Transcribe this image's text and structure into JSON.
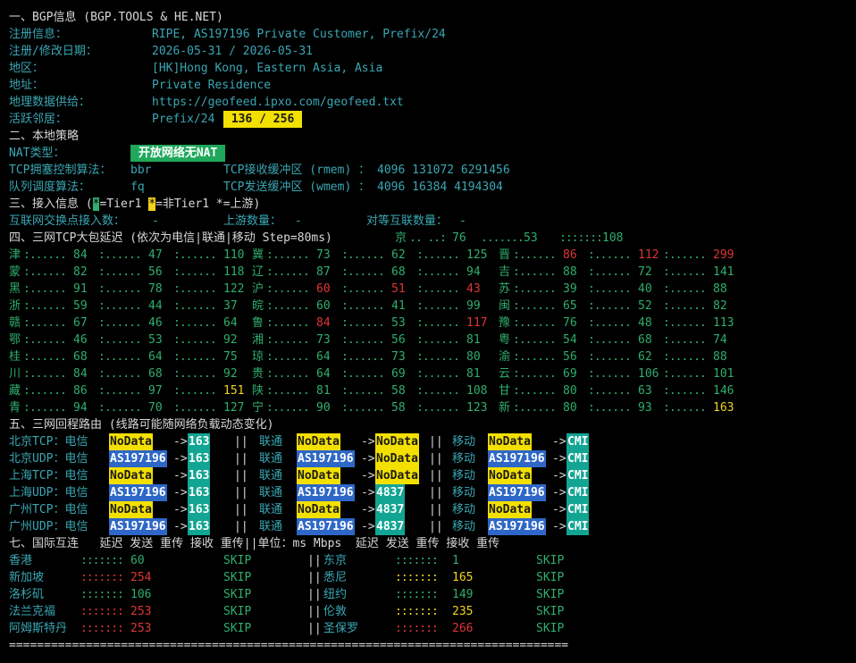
{
  "s1": {
    "title": "一、BGP信息 (BGP.TOOLS & HE.NET)",
    "reg_label": "注册信息：",
    "reg_value": "RIPE, AS197196 Private Customer, Prefix/24",
    "date_label": "注册/修改日期：",
    "date_value": "2026-05-31 / 2026-05-31",
    "region_label": "地区：",
    "region_value": "[HK]Hong Kong, Eastern Asia, Asia",
    "addr_label": "地址：",
    "addr_value": "Private Residence",
    "geo_label": "地理数据供给：",
    "geo_value": "https://geofeed.ipxo.com/geofeed.txt",
    "nbr_label": "活跃邻居：",
    "nbr_value": "Prefix/24",
    "nbr_badge": " 136 / 256 "
  },
  "s2": {
    "title": "二、本地策略",
    "nat_label": "NAT类型：",
    "nat_value": " 开放网络无NAT ",
    "cc_label": "TCP拥塞控制算法：",
    "cc_value": "bbr",
    "rmem_label": "TCP接收缓冲区 (rmem) ：",
    "rmem_value": "4096 131072 6291456",
    "q_label": "队列调度算法：",
    "q_value": "fq",
    "wmem_label": "TCP发送缓冲区 (wmem) ：",
    "wmem_value": "4096 16384 4194304"
  },
  "s3": {
    "title_a": "三、接入信息 (",
    "t1_mark": "*",
    "t1_text": "=Tier1 ",
    "nt1_mark": "*",
    "nt1_text": "=非Tier1 *=上游)",
    "ix_label": "互联网交换点接入数：",
    "ix_value": "-",
    "up_label": "上游数量：",
    "up_value": "-",
    "peer_label": "对等互联数量：",
    "peer_value": "-"
  },
  "s4": {
    "title": "四、三网TCP大包延迟 (依次为电信|联通|移动 Step=80ms)",
    "rows": [
      [
        {
          "p": "",
          "a": "",
          "b": "",
          "c": ""
        },
        {
          "p": "",
          "a": "",
          "b": "",
          "c": ""
        },
        {
          "p": "京",
          "a": "76",
          "b": "53",
          "c": "108"
        },
        {
          "p": "",
          "a": "",
          "b": "",
          "c": ""
        }
      ],
      [
        {
          "p": "津",
          "a": "84",
          "b": "47",
          "c": "110"
        },
        {
          "p": "冀",
          "a": "73",
          "b": "62",
          "c": "125"
        },
        {
          "p": "晋",
          "a": "86",
          "b": "112",
          "c": "299"
        },
        {
          "p": "",
          "a": "",
          "b": "",
          "c": ""
        }
      ],
      [
        {
          "p": "蒙",
          "a": "82",
          "b": "56",
          "c": "118"
        },
        {
          "p": "辽",
          "a": "87",
          "b": "68",
          "c": "94"
        },
        {
          "p": "吉",
          "a": "88",
          "b": "72",
          "c": "141"
        },
        {
          "p": "",
          "a": "",
          "b": "",
          "c": ""
        }
      ],
      [
        {
          "p": "黑",
          "a": "91",
          "b": "78",
          "c": "122"
        },
        {
          "p": "沪",
          "a": "60",
          "b": "51",
          "c": "43"
        },
        {
          "p": "苏",
          "a": "39",
          "b": "40",
          "c": "88"
        },
        {
          "p": "",
          "a": "",
          "b": "",
          "c": ""
        }
      ],
      [
        {
          "p": "浙",
          "a": "59",
          "b": "44",
          "c": "37"
        },
        {
          "p": "皖",
          "a": "60",
          "b": "41",
          "c": "99"
        },
        {
          "p": "闽",
          "a": "65",
          "b": "52",
          "c": "82"
        },
        {
          "p": "",
          "a": "",
          "b": "",
          "c": ""
        }
      ],
      [
        {
          "p": "赣",
          "a": "67",
          "b": "46",
          "c": "64"
        },
        {
          "p": "鲁",
          "a": "84",
          "b": "53",
          "c": "117"
        },
        {
          "p": "豫",
          "a": "76",
          "b": "48",
          "c": "113"
        },
        {
          "p": "",
          "a": "",
          "b": "",
          "c": ""
        }
      ],
      [
        {
          "p": "鄂",
          "a": "46",
          "b": "53",
          "c": "92"
        },
        {
          "p": "湘",
          "a": "73",
          "b": "56",
          "c": "81"
        },
        {
          "p": "粤",
          "a": "54",
          "b": "68",
          "c": "74"
        },
        {
          "p": "",
          "a": "",
          "b": "",
          "c": ""
        }
      ],
      [
        {
          "p": "桂",
          "a": "68",
          "b": "64",
          "c": "75"
        },
        {
          "p": "琼",
          "a": "64",
          "b": "73",
          "c": "80"
        },
        {
          "p": "渝",
          "a": "56",
          "b": "62",
          "c": "88"
        },
        {
          "p": "",
          "a": "",
          "b": "",
          "c": ""
        }
      ],
      [
        {
          "p": "川",
          "a": "84",
          "b": "68",
          "c": "92"
        },
        {
          "p": "贵",
          "a": "64",
          "b": "69",
          "c": "81"
        },
        {
          "p": "云",
          "a": "69",
          "b": "106",
          "c": "101"
        },
        {
          "p": "",
          "a": "",
          "b": "",
          "c": ""
        }
      ],
      [
        {
          "p": "藏",
          "a": "86",
          "b": "97",
          "c": "151"
        },
        {
          "p": "陕",
          "a": "81",
          "b": "58",
          "c": "108"
        },
        {
          "p": "甘",
          "a": "80",
          "b": "63",
          "c": "146"
        },
        {
          "p": "",
          "a": "",
          "b": "",
          "c": ""
        }
      ],
      [
        {
          "p": "青",
          "a": "94",
          "b": "70",
          "c": "127"
        },
        {
          "p": "宁",
          "a": "90",
          "b": "58",
          "c": "123"
        },
        {
          "p": "新",
          "a": "80",
          "b": "93",
          "c": "163"
        },
        {
          "p": "",
          "a": "",
          "b": "",
          "c": ""
        }
      ]
    ]
  },
  "s5": {
    "title": "五、三网回程路由 (线路可能随网络负载动态变化)",
    "rows": [
      {
        "label": "北京TCP：电信",
        "t1": "NoData",
        "t2": "163",
        "u_label": "联通",
        "u1": "NoData",
        "u2": "NoData",
        "m_label": "移动",
        "m1": "NoData",
        "m2": "CMI"
      },
      {
        "label": "北京UDP：电信",
        "t1": "AS197196",
        "t2": "163",
        "u_label": "联通",
        "u1": "AS197196",
        "u2": "NoData",
        "m_label": "移动",
        "m1": "AS197196",
        "m2": "CMI"
      },
      {
        "label": "上海TCP：电信",
        "t1": "NoData",
        "t2": "163",
        "u_label": "联通",
        "u1": "NoData",
        "u2": "NoData",
        "m_label": "移动",
        "m1": "NoData",
        "m2": "CMI"
      },
      {
        "label": "上海UDP：电信",
        "t1": "AS197196",
        "t2": "163",
        "u_label": "联通",
        "u1": "AS197196",
        "u2": "4837",
        "m_label": "移动",
        "m1": "AS197196",
        "m2": "CMI"
      },
      {
        "label": "广州TCP：电信",
        "t1": "NoData",
        "t2": "163",
        "u_label": "联通",
        "u1": "NoData",
        "u2": "4837",
        "m_label": "移动",
        "m1": "NoData",
        "m2": "CMI"
      },
      {
        "label": "广州UDP：电信",
        "t1": "AS197196",
        "t2": "163",
        "u_label": "联通",
        "u1": "AS197196",
        "u2": "4837",
        "m_label": "移动",
        "m1": "AS197196",
        "m2": "CMI"
      }
    ]
  },
  "s7": {
    "header": "七、国际互连   延迟 发送 重传 接收 重传||单位：ms Mbps  延迟 发送 重传 接收 重传",
    "rows": [
      {
        "l": "香港",
        "lv": "60",
        "ls": "SKIP",
        "r": "东京",
        "rv": "1",
        "rs": "SKIP"
      },
      {
        "l": "新加坡",
        "lv": "254",
        "ls": "SKIP",
        "r": "悉尼",
        "rv": "165",
        "rs": "SKIP"
      },
      {
        "l": "洛杉矶",
        "lv": "106",
        "ls": "SKIP",
        "r": "纽约",
        "rv": "149",
        "rs": "SKIP"
      },
      {
        "l": "法兰克福",
        "lv": "253",
        "ls": "SKIP",
        "r": "伦敦",
        "rv": "235",
        "rs": "SKIP"
      },
      {
        "l": "阿姆斯特丹",
        "lv": "253",
        "ls": "SKIP",
        "r": "圣保罗",
        "rv": "266",
        "rs": "SKIP"
      }
    ],
    "sep": "||",
    "footer": "================================================================================"
  },
  "colors": {
    "bg": "#000000",
    "label": "#3aa7b4",
    "good": "#2fae6d",
    "warn": "#f3d21e",
    "bad": "#e03535"
  }
}
